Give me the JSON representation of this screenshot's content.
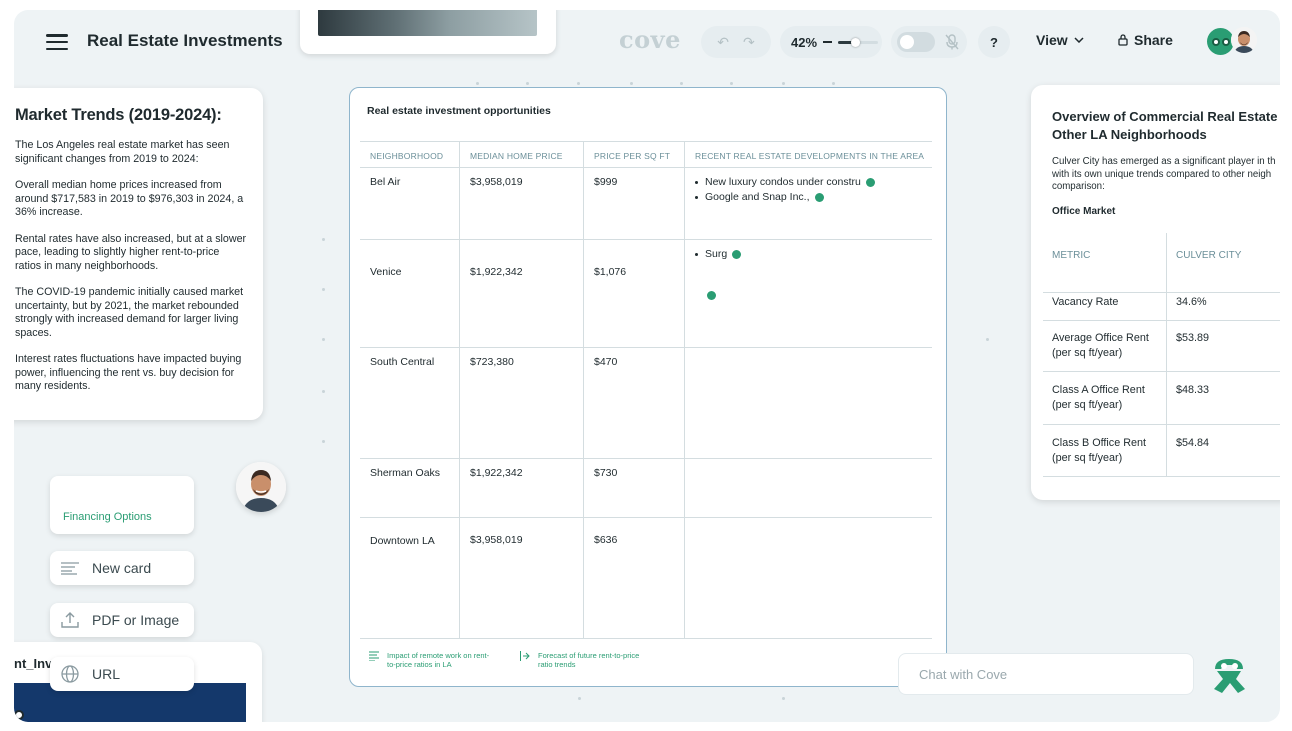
{
  "header": {
    "menu_icon": "hamburger-menu-icon",
    "doc_title": "Real Estate Investments",
    "brand": "cove",
    "zoom": "42%",
    "zoom_level": 0.42,
    "help": "?",
    "view_label": "View",
    "share_label": "Share"
  },
  "market_card": {
    "title": "Market Trends (2019-2024):",
    "paragraphs": [
      "The Los Angeles real estate market has seen significant changes from 2019 to 2024:",
      "Overall median home prices increased from around $717,583 in 2019 to $976,303 in 2024, a 36% increase.",
      "Rental rates have also increased, but at a slower pace, leading to slightly higher rent-to-price ratios in many neighborhoods.",
      "The COVID-19 pandemic initially caused market uncertainty, but by 2021, the market rebounded strongly with increased demand for larger living spaces.",
      "Interest rates fluctuations have impacted buying power, influencing the rent vs. buy decision for many residents."
    ]
  },
  "left_actions": {
    "financing": "Financing Options",
    "new_card": "New card",
    "pdf_image": "PDF or Image",
    "url": "URL"
  },
  "bottom_card": {
    "label": "nt_Inv"
  },
  "table_card": {
    "title": "Real estate investment opportunities",
    "columns": [
      "NEIGHBORHOOD",
      "MEDIAN HOME PRICE",
      "PRICE PER SQ FT",
      "RECENT REAL ESTATE DEVELOPMENTS IN THE AREA"
    ],
    "rows": [
      {
        "neighborhood": "Bel Air",
        "median": "$3,958,019",
        "ppsf": "$999",
        "dev": [
          "New luxury condos under constru",
          "Google and Snap Inc.,"
        ]
      },
      {
        "neighborhood": "Venice",
        "median": "$1,922,342",
        "ppsf": "$1,076",
        "dev": [
          "Surg"
        ]
      },
      {
        "neighborhood": "South Central",
        "median": "$723,380",
        "ppsf": "$470",
        "dev": []
      },
      {
        "neighborhood": "Sherman Oaks",
        "median": "$1,922,342",
        "ppsf": "$730",
        "dev": []
      },
      {
        "neighborhood": "Downtown LA",
        "median": "$3,958,019",
        "ppsf": "$636",
        "dev": []
      }
    ],
    "footer_links": [
      "Impact of remote work on rent-to-price ratios in LA",
      "Forecast of future rent-to-price ratio trends"
    ]
  },
  "commercial_card": {
    "title_line1": "Overview of Commercial Real Estate T",
    "title_line2": "Other LA Neighborhoods",
    "desc_line1": "Culver City has emerged as a significant player in th",
    "desc_line2": "with its own unique trends compared to other neigh",
    "desc_line3": "comparison:",
    "subheading": "Office Market",
    "columns": [
      "METRIC",
      "CULVER CITY"
    ],
    "rows": [
      {
        "metric_l1": "Vacancy Rate",
        "metric_l2": "",
        "value": "34.6%"
      },
      {
        "metric_l1": "Average Office Rent",
        "metric_l2": "(per sq ft/year)",
        "value": "$53.89"
      },
      {
        "metric_l1": "Class A Office Rent",
        "metric_l2": "(per sq ft/year)",
        "value": "$48.33"
      },
      {
        "metric_l1": "Class B Office Rent",
        "metric_l2": "(per sq ft/year)",
        "value": "$54.84"
      }
    ]
  },
  "chat": {
    "placeholder": "Chat with Cove"
  },
  "colors": {
    "accent": "#2a9d73",
    "table_border": "#8fb5cc",
    "canvas": "#eef3f5"
  }
}
